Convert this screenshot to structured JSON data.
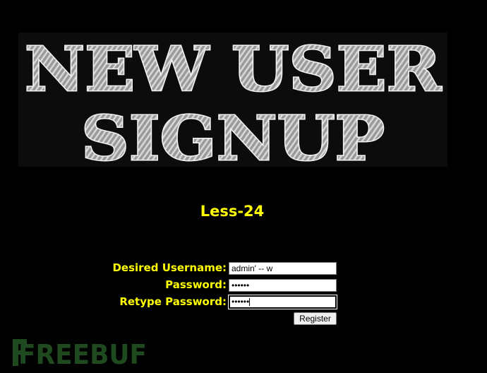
{
  "banner": {
    "line1": "NEW USER",
    "line2": "SIGNUP"
  },
  "level_title": "Less-24",
  "form": {
    "username_label": "Desired Username:",
    "username_value": "admin' -- w",
    "password_label": "Password:",
    "password_value": "••••••",
    "retype_label": "Retype Password:",
    "retype_value": "••••••",
    "register_label": "Register"
  },
  "watermark": {
    "text": "FREEBUF"
  },
  "colors": {
    "background": "#000000",
    "label": "#FFFF00",
    "banner_text": "#b8b8b8",
    "watermark": "#1f4a1f"
  }
}
